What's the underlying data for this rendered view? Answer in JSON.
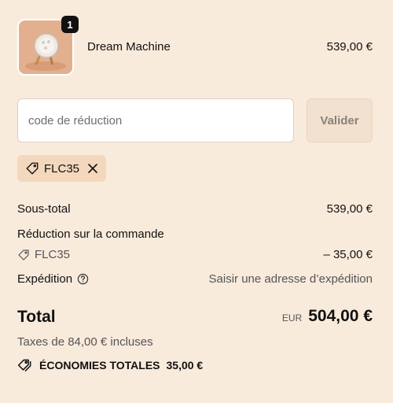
{
  "product": {
    "name": "Dream Machine",
    "price": "539,00 €",
    "quantity": "1",
    "thumbnail_icon": "product-thumbnail"
  },
  "discount": {
    "placeholder": "code de réduction",
    "value": "",
    "apply_label": "Valider",
    "applied_code": "FLC35"
  },
  "summary": {
    "subtotal_label": "Sous-total",
    "subtotal_value": "539,00 €",
    "order_discount_label": "Réduction sur la commande",
    "order_discount_code": "FLC35",
    "order_discount_value": "– 35,00 €",
    "shipping_label": "Expédition",
    "shipping_value": "Saisir une adresse d’expédition"
  },
  "total": {
    "label": "Total",
    "currency": "EUR",
    "amount": "504,00 €",
    "taxes": "Taxes de 84,00 € incluses",
    "savings_label": "ÉCONOMIES TOTALES",
    "savings_value": "35,00 €"
  },
  "colors": {
    "background": "#f9ebdc",
    "chip": "#f3d8bd",
    "button_bg": "#f2e1cf",
    "text": "#111111",
    "muted": "#555555"
  }
}
